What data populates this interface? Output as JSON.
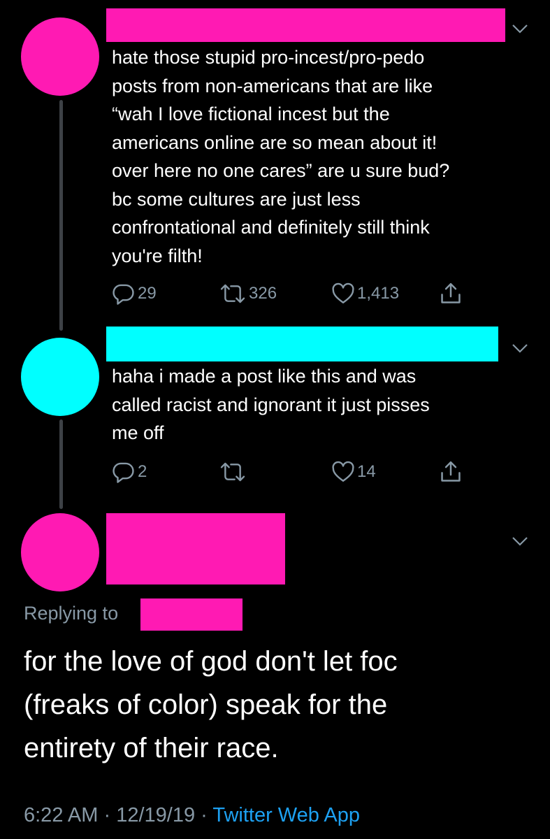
{
  "colors": {
    "background": "#000000",
    "redaction_pink": "#ff1ab3",
    "redaction_cyan": "#00ffff",
    "muted_text": "#8899a6",
    "link_blue": "#1da1f2",
    "thread_line": "#3d4146"
  },
  "tweets": [
    {
      "avatar_color": "#ff1ab3",
      "lines": [
        "hate those stupid pro-incest/pro-pedo",
        "posts from non-americans that are like",
        "“wah I love fictional incest but the",
        "americans online are so mean about it!",
        "over here no one cares” are u sure bud?",
        "bc some cultures are just less",
        "confrontational and definitely still think",
        "you're filth!"
      ],
      "actions": {
        "reply_icon": "reply-icon",
        "reply_count": "29",
        "retweet_icon": "retweet-icon",
        "retweet_count": "326",
        "like_icon": "heart-icon",
        "like_count": "1,413",
        "share_icon": "share-icon"
      }
    },
    {
      "avatar_color": "#00ffff",
      "lines": [
        "haha i made a post like this and was",
        "called racist and ignorant it just pisses",
        "me off"
      ],
      "actions": {
        "reply_icon": "reply-icon",
        "reply_count": "2",
        "retweet_icon": "retweet-icon",
        "retweet_count": "",
        "like_icon": "heart-icon",
        "like_count": "14",
        "share_icon": "share-icon"
      }
    }
  ],
  "main_tweet": {
    "avatar_color": "#ff1ab3",
    "replying_to_label": "Replying to",
    "lines": [
      "for the love of god don't let foc",
      "(freaks of color) speak for the",
      "entirety of their race."
    ],
    "time": "6:22 AM",
    "separator": " · ",
    "date": "12/19/19",
    "source": "Twitter Web App"
  }
}
